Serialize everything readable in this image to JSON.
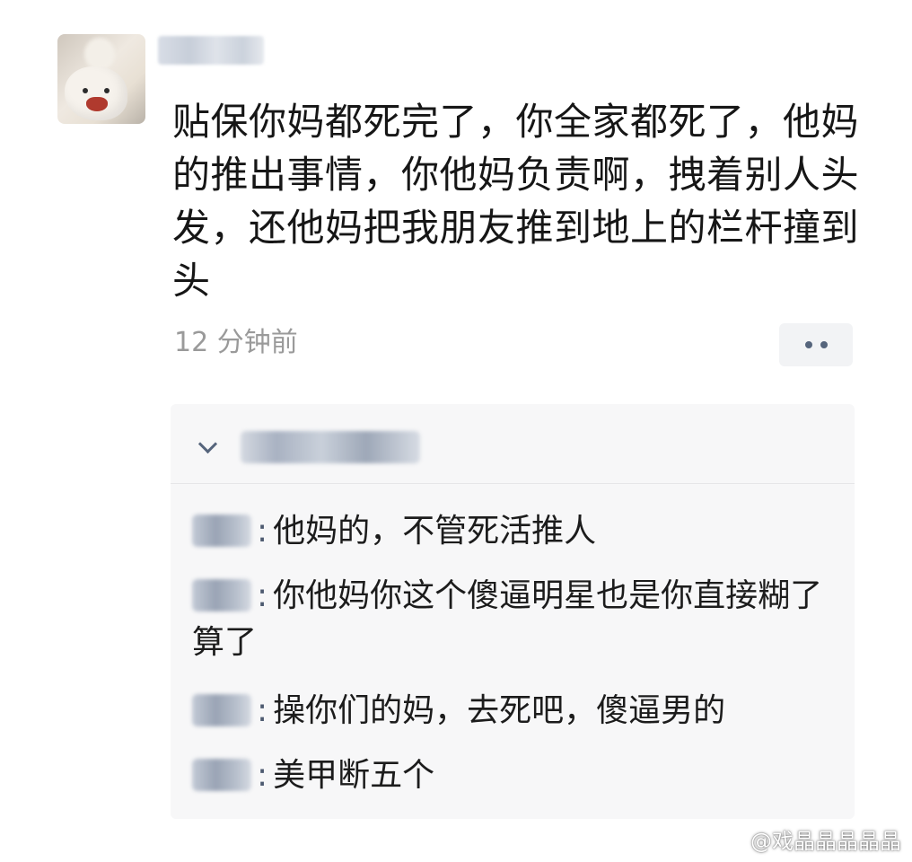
{
  "post": {
    "text": "贴保你妈都死完了，你全家都死了，他妈的推出事情，你他妈负责啊，拽着别人头发，还他妈把我朋友推到地上的栏杆撞到头",
    "timestamp": "12 分钟前"
  },
  "comments": [
    {
      "separator": ":",
      "text": "他妈的，不管死活推人"
    },
    {
      "separator": ":",
      "text": "你他妈你这个傻逼明星也是你直接糊了算了"
    },
    {
      "separator": ":",
      "text": "操你们的妈，去死吧，傻逼男的"
    },
    {
      "separator": ":",
      "text": "美甲断五个"
    }
  ],
  "watermark": "@戏晶晶晶晶晶",
  "icons": {
    "more": "more-dots-icon",
    "expand": "chevron-down-icon"
  },
  "colors": {
    "text": "#161616",
    "muted": "#9a9a9a",
    "panel": "#f7f7f8",
    "accent": "#56657c"
  }
}
